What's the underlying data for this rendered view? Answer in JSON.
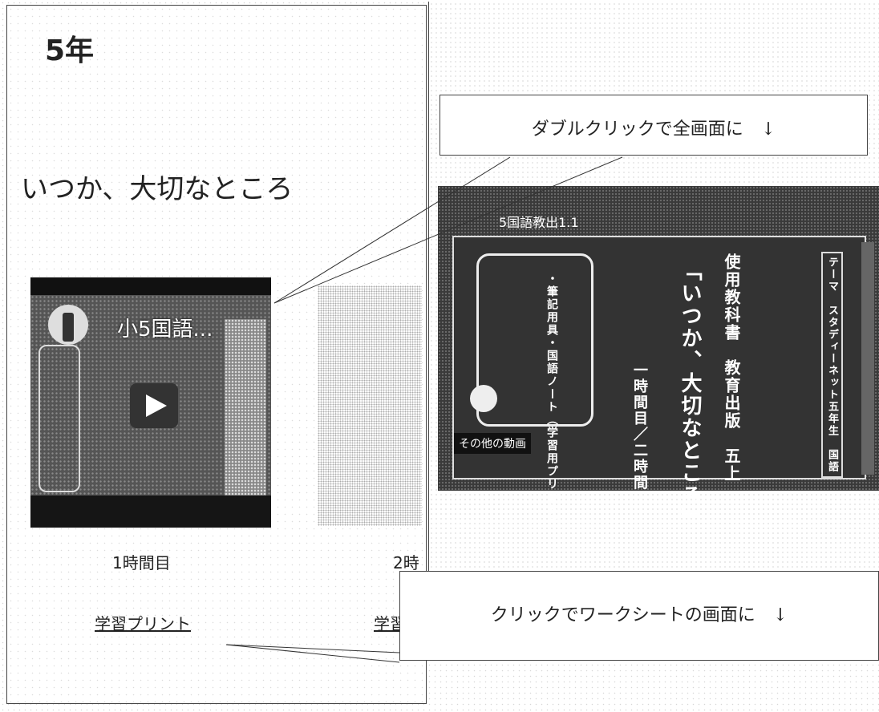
{
  "left_page": {
    "grade": "5年",
    "lesson_title": "いつか、大切なところ",
    "video_thumbnail_title": "小5国語...",
    "period_1": "1時間目",
    "period_2": "2時",
    "print_link_1": "学習プリント",
    "print_link_2": "学習"
  },
  "right_player": {
    "video_title": "5国語教出1.1",
    "board_textbook": "使用教科書　教育出版　五上",
    "board_lesson": "「いつか、大切なところ」",
    "board_time": "一時間目／二時間",
    "board_items": "・筆記用具・国語ノート（学習用プリント）",
    "board_right": "テーマ　スタディーネット五年生　国語",
    "more_videos": "その他の動画"
  },
  "callouts": {
    "double_click": "ダブルクリックで全画面に　↓",
    "click_worksheet": "クリックでワークシートの画面に　↓"
  },
  "colors": {
    "video_bg": "#3a3a3a",
    "text": "#222222"
  }
}
